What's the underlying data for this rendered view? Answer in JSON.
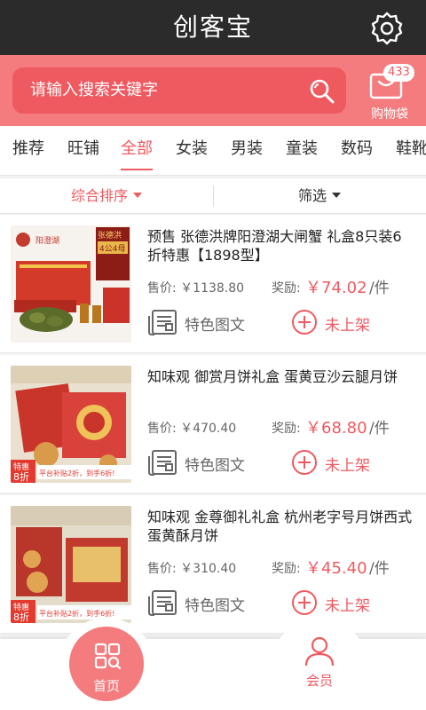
{
  "header": {
    "title": "创客宝",
    "settings_icon": "gear-icon"
  },
  "search": {
    "placeholder": "请输入搜索关键字",
    "icon": "search-icon"
  },
  "cart": {
    "badge": "433",
    "label": "购物袋",
    "icon": "shopping-bag-icon"
  },
  "tabs": [
    {
      "label": "推荐",
      "active": false
    },
    {
      "label": "旺铺",
      "active": false
    },
    {
      "label": "全部",
      "active": true
    },
    {
      "label": "女装",
      "active": false
    },
    {
      "label": "男装",
      "active": false
    },
    {
      "label": "童装",
      "active": false
    },
    {
      "label": "数码",
      "active": false
    },
    {
      "label": "鞋靴",
      "active": false
    }
  ],
  "sort": {
    "comprehensive": "综合排序",
    "filter": "筛选"
  },
  "products": [
    {
      "name": "预售 张德洪牌阳澄湖大闸蟹 礼盒8只装6折特惠【1898型】",
      "price_label": "售价: ￥1138.80",
      "reward_label": "奖励:",
      "reward": "￥74.02",
      "unit": "/件",
      "feature_label": "特色图文",
      "status_label": "未上架",
      "thumb_text": "张德洪",
      "thumb_sub": "4公4母"
    },
    {
      "name": "知味观 御赏月饼礼盒  蛋黄豆沙云腿月饼",
      "price_label": "售价: ￥470.40",
      "reward_label": "奖励:",
      "reward": "￥68.80",
      "unit": "/件",
      "feature_label": "特色图文",
      "status_label": "未上架",
      "thumb_text": "特惠",
      "thumb_sub": "8折",
      "thumb_banner": "平台补贴2折，到手6折!"
    },
    {
      "name": "知味观 金尊御礼礼盒  杭州老字号月饼西式蛋黄酥月饼",
      "price_label": "售价: ￥310.40",
      "reward_label": "奖励:",
      "reward": "￥45.40",
      "unit": "/件",
      "feature_label": "特色图文",
      "status_label": "未上架",
      "thumb_text": "特惠",
      "thumb_sub": "8折",
      "thumb_banner": "平台补贴2折，到手6折!"
    }
  ],
  "nav": {
    "home": "首页",
    "member": "会员"
  },
  "colors": {
    "accent": "#ef5a60",
    "header_bg": "#2b2b2b",
    "search_bg": "#f47b7e"
  }
}
